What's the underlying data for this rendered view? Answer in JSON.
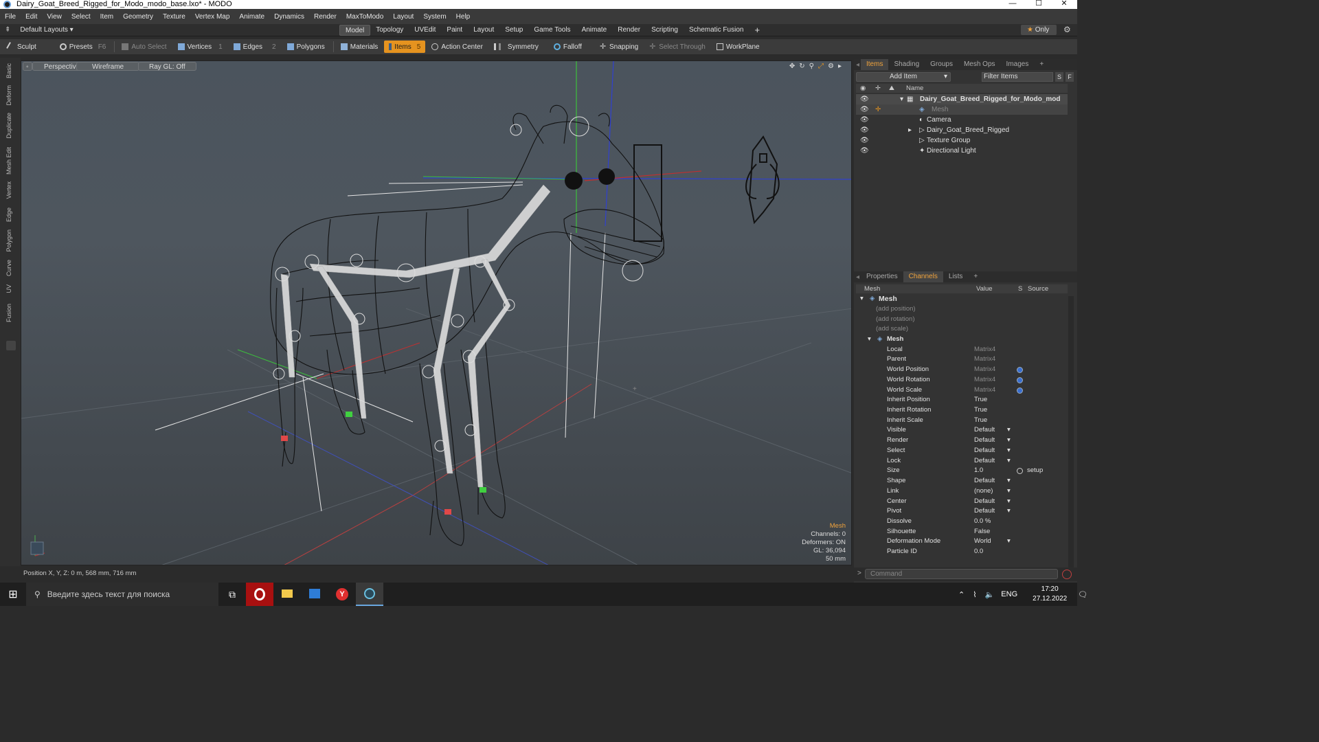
{
  "window": {
    "title": "Dairy_Goat_Breed_Rigged_for_Modo_modo_base.lxo* - MODO",
    "minimize": "—",
    "maximize": "☐",
    "close": "✕"
  },
  "menu": [
    "File",
    "Edit",
    "View",
    "Select",
    "Item",
    "Geometry",
    "Texture",
    "Vertex Map",
    "Animate",
    "Dynamics",
    "Render",
    "MaxToModo",
    "Layout",
    "System",
    "Help"
  ],
  "layout": {
    "preset": "Default Layouts",
    "tabs": [
      "Model",
      "Topology",
      "UVEdit",
      "Paint",
      "Layout",
      "Setup",
      "Game Tools",
      "Animate",
      "Render",
      "Scripting",
      "Schematic Fusion"
    ],
    "active_tab": "Model",
    "add": "+",
    "only": "Only",
    "star": "★"
  },
  "toolbar": {
    "sculpt": "Sculpt",
    "presets": "Presets",
    "presets_key": "F6",
    "auto_select": "Auto Select",
    "vertices": "Vertices",
    "vertices_count": "1",
    "edges": "Edges",
    "edges_count": "2",
    "polygons": "Polygons",
    "materials": "Materials",
    "items": "Items",
    "items_count": "5",
    "action_center": "Action Center",
    "symmetry": "Symmetry",
    "falloff": "Falloff",
    "snapping": "Snapping",
    "select_through": "Select Through",
    "workplane": "WorkPlane"
  },
  "left_tabs": [
    "Basic",
    "Deform",
    "Duplicate",
    "Mesh Edit",
    "Vertex",
    "Edge",
    "Polygon",
    "Curve",
    "UV",
    "Fusion"
  ],
  "viewport": {
    "view": "Perspective",
    "shading": "Wireframe",
    "raygl": "Ray GL: Off",
    "info_title": "Mesh",
    "info_lines": [
      "Channels: 0",
      "Deformers: ON",
      "GL: 36,094",
      "50 mm"
    ]
  },
  "status": "Position X, Y, Z:   0 m, 568 mm, 716 mm",
  "items_panel": {
    "tabs": [
      "Items",
      "Shading",
      "Groups",
      "Mesh Ops",
      "Images"
    ],
    "active": "Items",
    "add_item": "Add Item",
    "filter": "Filter Items",
    "col_name": "Name",
    "rows": [
      {
        "name": "Dairy_Goat_Breed_Rigged_for_Modo_mod ...",
        "bold": true
      },
      {
        "name": "Mesh",
        "dim": true
      },
      {
        "name": "Camera"
      },
      {
        "name": "Dairy_Goat_Breed_Rigged"
      },
      {
        "name": "Texture Group"
      },
      {
        "name": "Directional Light"
      }
    ]
  },
  "channels_panel": {
    "tabs": [
      "Properties",
      "Channels",
      "Lists"
    ],
    "active": "Channels",
    "headers": {
      "name": "Mesh",
      "value": "Value",
      "s": "S",
      "source": "Source"
    },
    "group": "Mesh",
    "adds": [
      "(add position)",
      "(add rotation)",
      "(add scale)"
    ],
    "sub": "Mesh",
    "rows": [
      {
        "name": "Local",
        "value": "Matrix4",
        "gray": true
      },
      {
        "name": "Parent",
        "value": "Matrix4",
        "gray": true
      },
      {
        "name": "World Position",
        "value": "Matrix4",
        "gray": true,
        "link": true
      },
      {
        "name": "World Rotation",
        "value": "Matrix4",
        "gray": true,
        "link": true
      },
      {
        "name": "World Scale",
        "value": "Matrix4",
        "gray": true,
        "link": true
      },
      {
        "name": "Inherit Position",
        "value": "True"
      },
      {
        "name": "Inherit Rotation",
        "value": "True"
      },
      {
        "name": "Inherit Scale",
        "value": "True"
      },
      {
        "name": "Visible",
        "value": "Default",
        "dd": true
      },
      {
        "name": "Render",
        "value": "Default",
        "dd": true
      },
      {
        "name": "Select",
        "value": "Default",
        "dd": true
      },
      {
        "name": "Lock",
        "value": "Default",
        "dd": true
      },
      {
        "name": "Size",
        "value": "1.0",
        "source": "setup",
        "radio": true
      },
      {
        "name": "Shape",
        "value": "Default",
        "dd": true
      },
      {
        "name": "Link",
        "value": "(none)",
        "dd": true
      },
      {
        "name": "Center",
        "value": "Default",
        "dd": true
      },
      {
        "name": "Pivot",
        "value": "Default",
        "dd": true
      },
      {
        "name": "Dissolve",
        "value": "0.0 %"
      },
      {
        "name": "Silhouette",
        "value": "False"
      },
      {
        "name": "Deformation Mode",
        "value": "World",
        "dd": true
      },
      {
        "name": "Particle ID",
        "value": "0.0"
      }
    ]
  },
  "command": {
    "prompt": ">",
    "placeholder": "Command"
  },
  "taskbar": {
    "search": "Введите здесь текст для поиска",
    "lang": "ENG",
    "time": "17:20",
    "date": "27.12.2022"
  },
  "colors": {
    "accent": "#e5931f",
    "active_tab": "#f0a33c"
  }
}
